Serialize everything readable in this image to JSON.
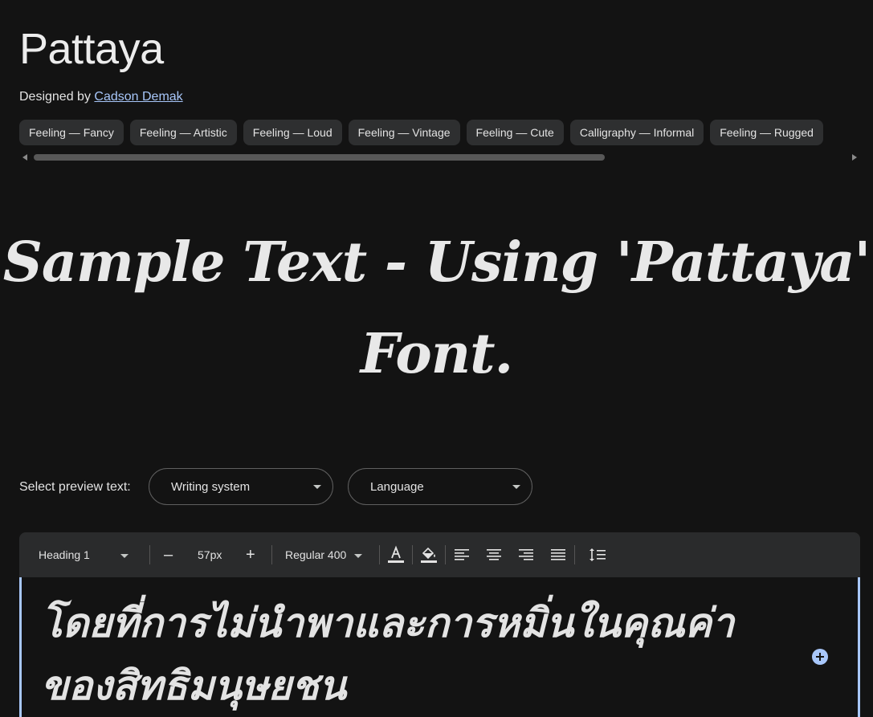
{
  "font": {
    "name": "Pattaya",
    "designed_by_prefix": "Designed by",
    "designer": "Cadson Demak"
  },
  "tags": [
    "Feeling — Fancy",
    "Feeling — Artistic",
    "Feeling — Loud",
    "Feeling — Vintage",
    "Feeling — Cute",
    "Calligraphy — Informal",
    "Feeling — Rugged"
  ],
  "sample": {
    "line1": "Sample Text - Using 'Pattaya'",
    "line2": "Font."
  },
  "preview": {
    "label": "Select preview text:",
    "writing_system": "Writing system",
    "language": "Language"
  },
  "toolbar": {
    "style": "Heading 1",
    "size": "57px",
    "decrease": "–",
    "increase": "+",
    "weight": "Regular 400"
  },
  "editor": {
    "text": "โดยที่การไม่นำพาและการหมิ่นในคุณค่าของสิทธิมนุษยชน"
  },
  "colors": {
    "background": "#131313",
    "accent": "#a8c7fa",
    "chip": "#2e2f30",
    "toolbar": "#2a2b2c"
  }
}
